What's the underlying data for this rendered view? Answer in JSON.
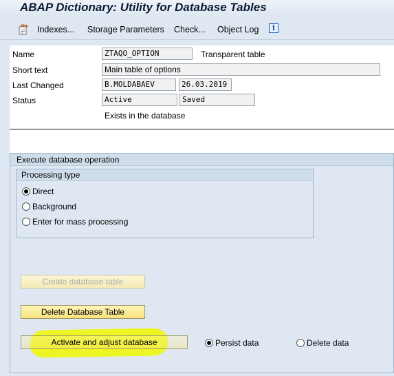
{
  "title": "ABAP Dictionary: Utility for Database Tables",
  "toolbar": {
    "items": [
      "Indexes...",
      "Storage Parameters",
      "Check...",
      "Object Log"
    ],
    "icons": [
      "toggle-display-change-icon",
      "info-icon"
    ]
  },
  "fields": {
    "name_label": "Name",
    "name_value": "ZTAQO_OPTION",
    "table_type": "Transparent table",
    "short_text_label": "Short text",
    "short_text_value": "Main table of options",
    "last_changed_label": "Last Changed",
    "last_changed_user": "B.MOLDABAEV",
    "last_changed_date": "26.03.2019",
    "status_label": "Status",
    "status_value": "Active",
    "status_state": "Saved",
    "db_info": "Exists in the database"
  },
  "db_operation": {
    "title": "Execute database operation",
    "processing_type": {
      "title": "Processing type",
      "options": [
        "Direct",
        "Background",
        "Enter for mass processing"
      ],
      "selected": "Direct"
    },
    "buttons": {
      "create": "Create database table",
      "delete": "Delete Database Table",
      "activate": "Activate and adjust database"
    },
    "data_options": {
      "persist": "Persist data",
      "delete": "Delete data",
      "selected": "Persist data"
    }
  },
  "colors": {
    "button_bg": "#f7e27d",
    "highlight": "#f0f700"
  }
}
